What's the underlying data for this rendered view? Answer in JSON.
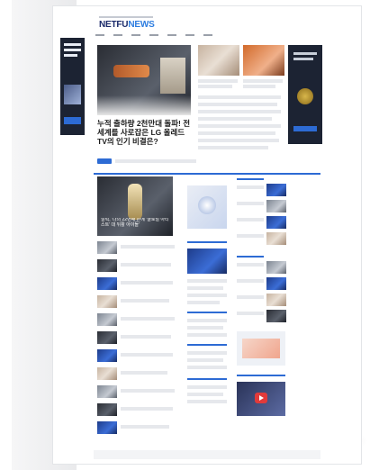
{
  "site": {
    "logo_main": "NETFU",
    "logo_accent": "NEWS"
  },
  "hero": {
    "headline": "누적 출하량 2천만대 돌파! 전 세계를 사로잡은 LG 올레드 TV의 인기 비결은?"
  },
  "feature_card": {
    "caption": "알릭, '나의 22번째 손에 '글로벌 아티스트' 대 뒤활 아이돌'"
  },
  "colors": {
    "accent": "#2d6bd4",
    "navy": "#1a2a6a",
    "sidebar_dark": "#1c2333"
  },
  "icons": [
    "play-icon",
    "video-play-icon"
  ]
}
